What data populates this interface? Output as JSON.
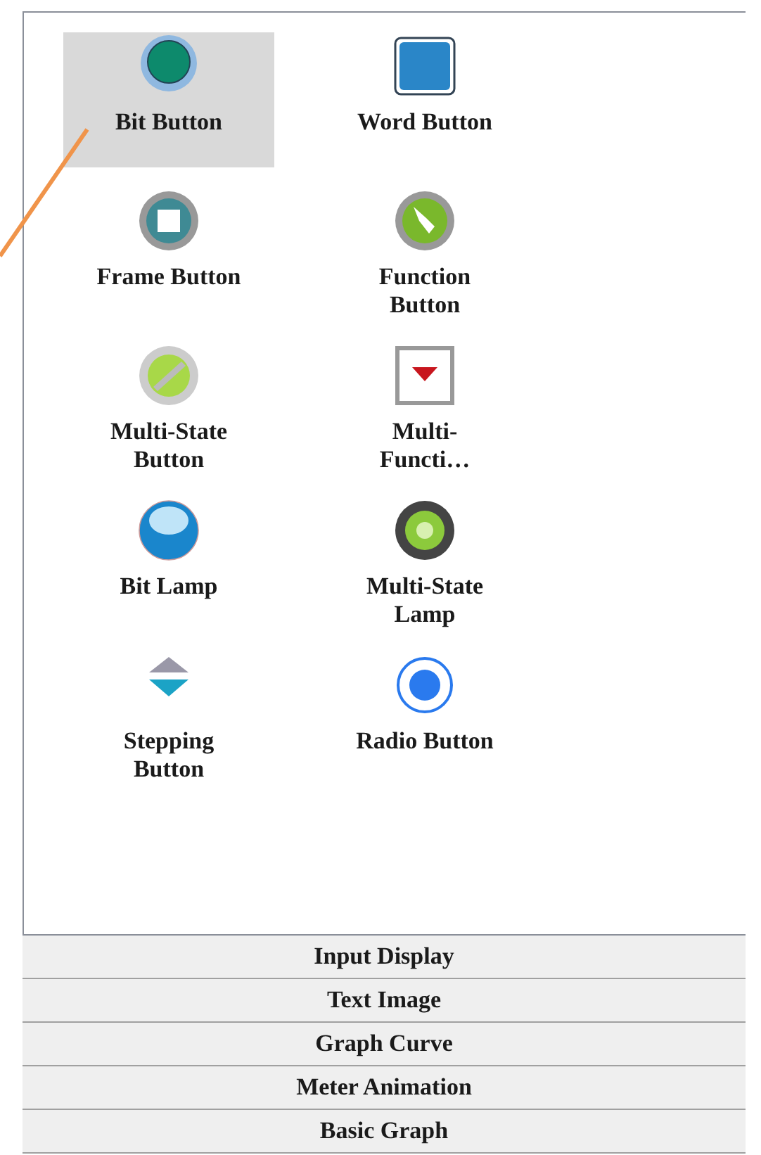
{
  "toolbox": {
    "items": [
      {
        "kind": "bit-button",
        "label": "Bit Button",
        "selected": true
      },
      {
        "kind": "word-button",
        "label": "Word Button",
        "selected": false
      },
      {
        "kind": "frame-button",
        "label": "Frame Button",
        "selected": false
      },
      {
        "kind": "function-button",
        "label": "Function\nButton",
        "selected": false
      },
      {
        "kind": "multistate-button",
        "label": "Multi-State\nButton",
        "selected": false
      },
      {
        "kind": "multifunction-button",
        "label": "Multi-\nFuncti…",
        "selected": false
      },
      {
        "kind": "bit-lamp",
        "label": "Bit Lamp",
        "selected": false
      },
      {
        "kind": "multistate-lamp",
        "label": "Multi-State\nLamp",
        "selected": false
      },
      {
        "kind": "stepping-button",
        "label": "Stepping\nButton",
        "selected": false
      },
      {
        "kind": "radio-button",
        "label": "Radio Button",
        "selected": false
      }
    ]
  },
  "sections": [
    "Input Display",
    "Text Image",
    "Graph Curve",
    "Meter Animation",
    "Basic Graph"
  ]
}
